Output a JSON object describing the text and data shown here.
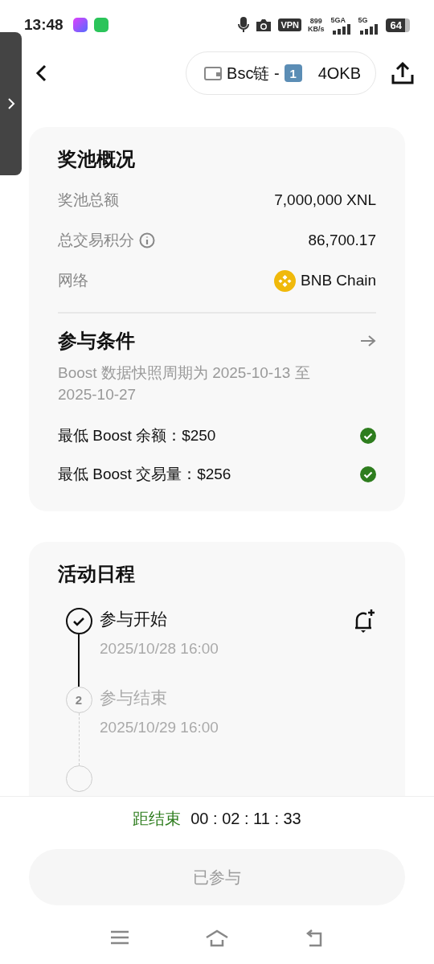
{
  "status_bar": {
    "time": "13:48",
    "vpn": "VPN",
    "speed_value": "899",
    "speed_unit": "KB/s",
    "network_1": "5GA",
    "network_2": "5G",
    "battery": "64"
  },
  "header": {
    "chain_label": "Bsc链 -",
    "keycap": "1",
    "account": "4OKB"
  },
  "pool": {
    "title": "奖池概况",
    "rows": [
      {
        "kind": "text",
        "label": "奖池总额",
        "value": "7,000,000 XNL"
      },
      {
        "kind": "info",
        "label": "总交易积分",
        "value": "86,700.17"
      },
      {
        "kind": "network",
        "label": "网络",
        "value": "BNB Chain"
      }
    ]
  },
  "conditions": {
    "title": "参与条件",
    "description": "Boost 数据快照周期为 2025-10-13 至 2025-10-27",
    "items": [
      {
        "label": "最低 Boost 余额：$250",
        "met": true
      },
      {
        "label": "最低 Boost 交易量：$256",
        "met": true
      }
    ]
  },
  "schedule": {
    "title": "活动日程",
    "steps": [
      {
        "title": "参与开始",
        "date": "2025/10/28 16:00",
        "done": true,
        "reminder": true
      },
      {
        "number": "2",
        "title": "参与结束",
        "date": "2025/10/29 16:00",
        "done": false
      },
      {
        "done": false
      }
    ]
  },
  "footer": {
    "countdown_label": "距结束",
    "countdown": "00 : 02 : 11 : 33",
    "button": "已参与",
    "button_disabled": true
  }
}
